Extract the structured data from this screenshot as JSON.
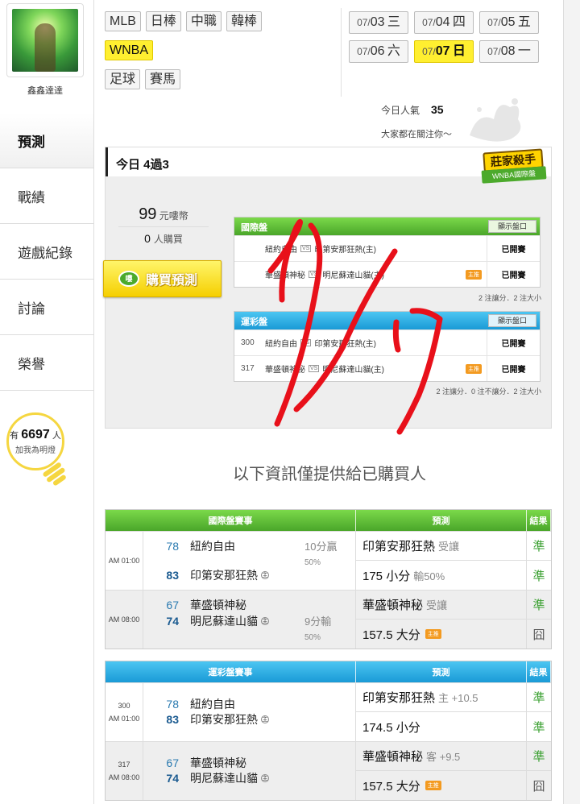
{
  "user": {
    "name": "鑫鑫達達"
  },
  "nav": {
    "items": [
      "預測",
      "戰績",
      "遊戲紀錄",
      "討論",
      "榮譽"
    ]
  },
  "fans": {
    "prefix": "有",
    "count": "6697",
    "suffix": "人",
    "line2": "加我為明燈"
  },
  "categories": {
    "row1": [
      "MLB",
      "日棒",
      "中職",
      "韓棒"
    ],
    "row2": [
      "WNBA"
    ],
    "row3": [
      "足球",
      "賽馬"
    ],
    "active": "WNBA"
  },
  "dates": [
    {
      "md": "07/",
      "d": "03",
      "w": "三"
    },
    {
      "md": "07/",
      "d": "04",
      "w": "四"
    },
    {
      "md": "07/",
      "d": "05",
      "w": "五"
    },
    {
      "md": "07/",
      "d": "06",
      "w": "六"
    },
    {
      "md": "07/",
      "d": "07",
      "w": "日"
    },
    {
      "md": "07/",
      "d": "08",
      "w": "一"
    }
  ],
  "popularity": {
    "label": "今日人氣",
    "value": "35",
    "caption": "大家都在關注你～"
  },
  "panel": {
    "title": "今日 4過3",
    "badge_top": "莊家殺手",
    "badge_bottom": "WNBA國際盤",
    "price": "99",
    "price_unit": "元嘍幣",
    "buyers": "0",
    "buyers_unit": "人購買",
    "buy_label": "購買預測",
    "coin_label": "嘍",
    "intl": {
      "title": "國際盤",
      "show": "顯示盤口",
      "rows": [
        {
          "num": "",
          "away": "紐約自由",
          "vs": "VS",
          "home": "印第安那狂熱(主)",
          "zhu": "",
          "status": "已開賽"
        },
        {
          "num": "",
          "away": "華盛頓神秘",
          "vs": "VS",
          "home": "明尼蘇達山貓(主)",
          "zhu": "主推",
          "status": "已開賽"
        }
      ],
      "note": "2 注讓分．2 注大小"
    },
    "sport": {
      "title": "運彩盤",
      "show": "顯示盤口",
      "rows": [
        {
          "num": "300",
          "away": "紐約自由",
          "vs": "VS",
          "home": "印第安那狂熱(主)",
          "zhu": "",
          "status": "已開賽"
        },
        {
          "num": "317",
          "away": "華盛頓神秘",
          "vs": "VS",
          "home": "明尼蘇達山貓(主)",
          "zhu": "主推",
          "status": "已開賽"
        }
      ],
      "note": "2 注讓分．0 注不讓分．2 注大小"
    }
  },
  "notice": "以下資訊僅提供給已購買人",
  "intl_table": {
    "headers": [
      "國際盤賽事",
      "預測",
      "結果"
    ],
    "groups": [
      {
        "num": "",
        "time": "AM 01:00",
        "teams": [
          {
            "score": "78",
            "name": "紐約自由",
            "host": "",
            "win": false
          },
          {
            "score": "83",
            "name": "印第安那狂熱",
            "host": "主",
            "win": true
          }
        ],
        "ares1": "10分贏",
        "ares2": "50%",
        "preds": [
          {
            "main": "印第安那狂熱",
            "sub": "受讓",
            "zb": ""
          },
          {
            "main": "175 小分",
            "sub": "輸50%",
            "zb": ""
          }
        ],
        "results": [
          "準",
          "準"
        ]
      },
      {
        "num": "",
        "time": "AM 08:00",
        "teams": [
          {
            "score": "67",
            "name": "華盛頓神秘",
            "host": "",
            "win": false
          },
          {
            "score": "74",
            "name": "明尼蘇達山貓",
            "host": "主",
            "win": true
          }
        ],
        "ares1": "9分輸",
        "ares2": "50%",
        "preds": [
          {
            "main": "華盛頓神秘",
            "sub": "受讓",
            "zb": ""
          },
          {
            "main": "157.5 大分",
            "sub": "",
            "zb": "主推"
          }
        ],
        "results": [
          "準",
          "囧"
        ]
      }
    ]
  },
  "sport_table": {
    "headers": [
      "運彩盤賽事",
      "預測",
      "結果"
    ],
    "groups": [
      {
        "num": "300",
        "time": "AM 01:00",
        "teams": [
          {
            "score": "78",
            "name": "紐約自由",
            "host": "",
            "win": false
          },
          {
            "score": "83",
            "name": "印第安那狂熱",
            "host": "主",
            "win": true
          }
        ],
        "preds": [
          {
            "main": "印第安那狂熱",
            "sub": "主 +10.5",
            "zb": ""
          },
          {
            "main": "174.5 小分",
            "sub": "",
            "zb": ""
          }
        ],
        "results": [
          "準",
          "準"
        ]
      },
      {
        "num": "317",
        "time": "AM 08:00",
        "teams": [
          {
            "score": "67",
            "name": "華盛頓神秘",
            "host": "",
            "win": false
          },
          {
            "score": "74",
            "name": "明尼蘇達山貓",
            "host": "主",
            "win": true
          }
        ],
        "preds": [
          {
            "main": "華盛頓神秘",
            "sub": "客 +9.5",
            "zb": ""
          },
          {
            "main": "157.5 大分",
            "sub": "",
            "zb": "主推"
          }
        ],
        "results": [
          "準",
          "囧"
        ]
      }
    ]
  },
  "colors": {
    "accent_yellow": "#ffef30",
    "green_header": "#4aa62a",
    "blue_header": "#1a9ad6",
    "win_green": "#3aa030",
    "scribble_red": "#e8101a"
  }
}
